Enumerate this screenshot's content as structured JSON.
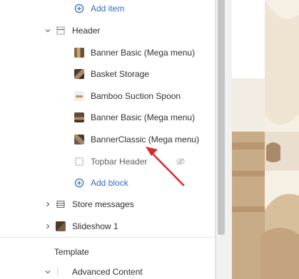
{
  "sidebar": {
    "add_item": "Add item",
    "header_section": "Header",
    "header_items": [
      {
        "label": "Banner Basic (Mega menu)",
        "icon": "banner-thumbnail-icon"
      },
      {
        "label": "Basket Storage",
        "icon": "basket-thumbnail-icon"
      },
      {
        "label": "Bamboo Suction Spoon",
        "icon": "spoon-thumbnail-icon"
      },
      {
        "label": "Banner Basic (Mega menu)",
        "icon": "banner-thumbnail-icon"
      },
      {
        "label": "BannerClassic (Mega menu)",
        "icon": "banner-thumbnail-icon"
      },
      {
        "label": "Topbar Header",
        "icon": "dashed-square-icon"
      }
    ],
    "add_block": "Add block",
    "sections": [
      {
        "label": "Store messages",
        "icon": "section-icon"
      },
      {
        "label": "Slideshow 1",
        "icon": "slideshow-icon"
      }
    ],
    "template_label": "Template",
    "advanced_content": "Advanced Content"
  },
  "colors": {
    "link": "#2c6ecb",
    "annotation_arrow": "#e0262b"
  }
}
